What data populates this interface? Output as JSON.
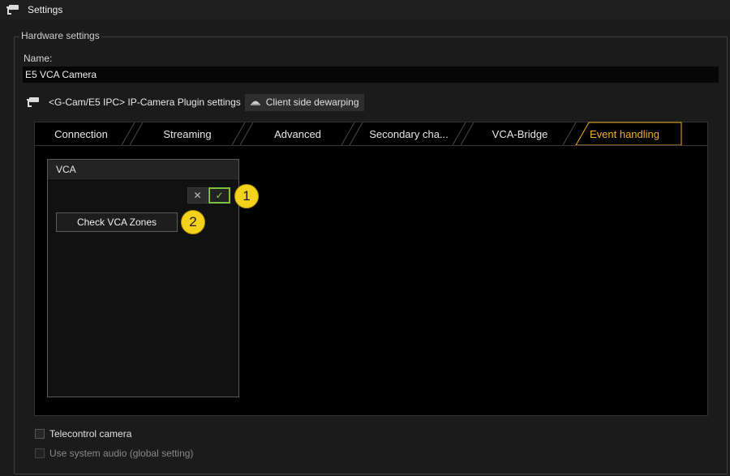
{
  "window": {
    "title": "Settings",
    "icon": "camera-icon"
  },
  "hardware_group": {
    "legend": "Hardware settings",
    "name_label": "Name:",
    "name_value": "E5 VCA Camera"
  },
  "plugin": {
    "icon": "camera-icon",
    "text": "<G-Cam/E5 IPC> IP-Camera Plugin settings",
    "dewarp_button": {
      "icon": "dome-camera-icon",
      "label": "Client side dewarping"
    }
  },
  "tabs": [
    {
      "label": "Connection",
      "active": false
    },
    {
      "label": "Streaming",
      "active": false
    },
    {
      "label": "Advanced",
      "active": false
    },
    {
      "label": "Secondary cha...",
      "active": false
    },
    {
      "label": "VCA-Bridge",
      "active": false
    },
    {
      "label": "Event handling",
      "active": true
    }
  ],
  "vca": {
    "title": "VCA",
    "toggle": {
      "off_symbol": "✕",
      "on_symbol": "✓",
      "state": "on"
    },
    "check_zones_label": "Check VCA Zones"
  },
  "callouts": [
    "1",
    "2"
  ],
  "options": [
    {
      "label": "Telecontrol camera",
      "checked": false,
      "enabled": true
    },
    {
      "label": "Use system audio (global setting)",
      "checked": false,
      "enabled": false
    }
  ],
  "colors": {
    "accent_active_tab": "#f2b01e",
    "toggle_on": "#7fbf3a",
    "callout": "#f4d21b",
    "background": "#1b1b1b",
    "panel": "#000000"
  }
}
